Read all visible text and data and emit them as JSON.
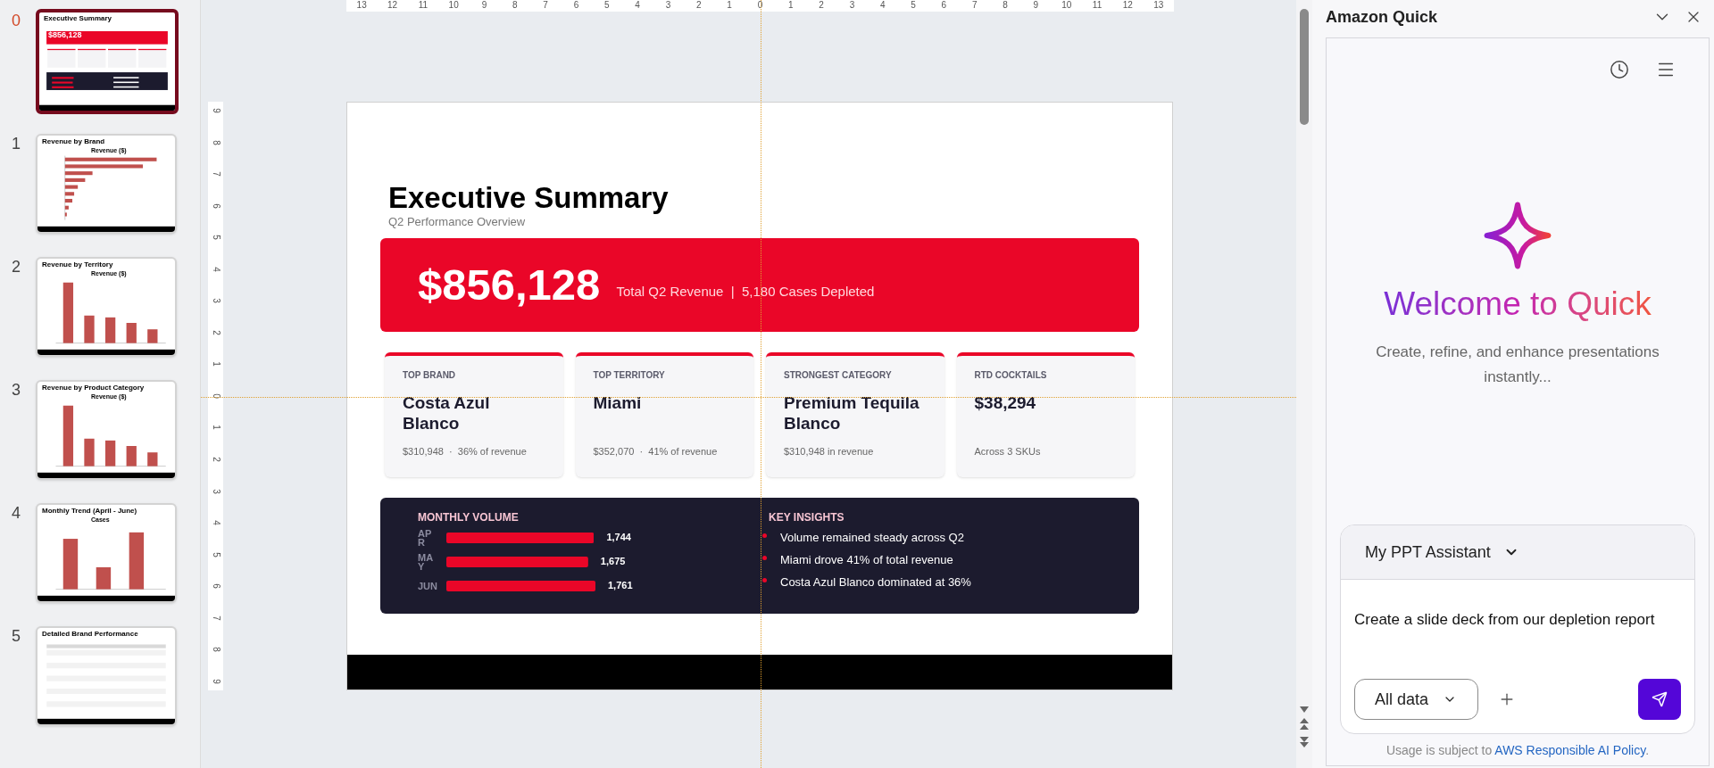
{
  "thumbnails": [
    {
      "number": "0",
      "title": "Executive Summary",
      "kind": "summary",
      "headline": "$856,128",
      "selected": true
    },
    {
      "number": "1",
      "title": "Revenue by Brand",
      "kind": "hbar",
      "chart_title": "Revenue ($)",
      "selected": false
    },
    {
      "number": "2",
      "title": "Revenue by Territory",
      "kind": "bar",
      "chart_title": "Revenue ($)",
      "selected": false
    },
    {
      "number": "3",
      "title": "Revenue by Product Category",
      "kind": "bar",
      "chart_title": "Revenue ($)",
      "selected": false
    },
    {
      "number": "4",
      "title": "Monthly Trend (April - June)",
      "kind": "bar3",
      "chart_title": "Cases",
      "selected": false
    },
    {
      "number": "5",
      "title": "Detailed Brand Performance",
      "kind": "table",
      "selected": false
    }
  ],
  "ruler_horizontal": [
    "13",
    "12",
    "11",
    "10",
    "9",
    "8",
    "7",
    "6",
    "5",
    "4",
    "3",
    "2",
    "1",
    "0",
    "1",
    "2",
    "3",
    "4",
    "5",
    "6",
    "7",
    "8",
    "9",
    "10",
    "11",
    "12",
    "13"
  ],
  "ruler_vertical": [
    "9",
    "8",
    "7",
    "6",
    "5",
    "4",
    "3",
    "2",
    "1",
    "0",
    "1",
    "2",
    "3",
    "4",
    "5",
    "6",
    "7",
    "8",
    "9"
  ],
  "slide": {
    "title": "Executive Summary",
    "subtitle": "Q2 Performance Overview",
    "banner": {
      "value": "$856,128",
      "caption": "Total Q2 Revenue  |  5,180 Cases Depleted"
    },
    "cards": [
      {
        "label": "TOP BRAND",
        "value": "Costa Azul Blanco",
        "detail": "$310,948  ·  36% of revenue"
      },
      {
        "label": "TOP TERRITORY",
        "value": "Miami",
        "detail": "$352,070  ·  41% of revenue"
      },
      {
        "label": "STRONGEST CATEGORY",
        "value": "Premium Tequila Blanco",
        "detail": "$310,948 in revenue"
      },
      {
        "label": "RTD COCKTAILS",
        "value": "$38,294",
        "detail": "Across 3 SKUs"
      }
    ],
    "volume": {
      "title": "MONTHLY VOLUME",
      "chart_data": {
        "type": "bar",
        "orientation": "horizontal",
        "categories": [
          "APR",
          "MAY",
          "JUN"
        ],
        "values": [
          1744,
          1675,
          1761
        ],
        "data_labels": true,
        "value_labels": [
          "1,744",
          "1,675",
          "1,761"
        ]
      }
    },
    "insights": {
      "title": "KEY INSIGHTS",
      "items": [
        "Volume remained steady across Q2",
        "Miami drove 41% of total revenue",
        "Costa Azul Blanco dominated at 36%"
      ]
    }
  },
  "panel": {
    "title": "Amazon Quick",
    "welcome": "Welcome to Quick",
    "description": "Create, refine, and enhance presentations instantly...",
    "assistant": "My PPT Assistant",
    "prompt": "Create a slide deck from our depletion report",
    "scope": "All data",
    "usage": {
      "text": "Usage is subject to",
      "link": "AWS Responsible AI Policy",
      "suffix": "."
    }
  }
}
